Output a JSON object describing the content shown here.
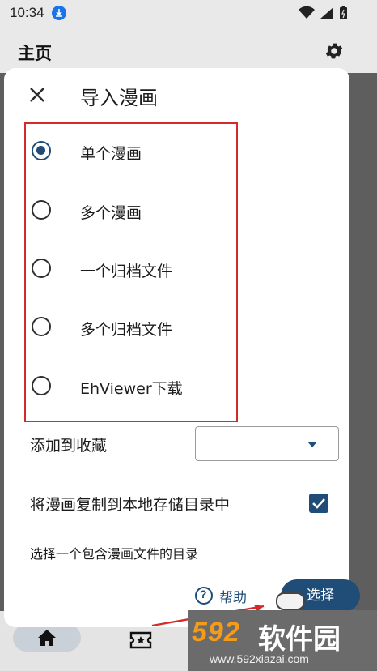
{
  "status_bar": {
    "time": "10:34"
  },
  "app_bar": {
    "title": "主页"
  },
  "dialog": {
    "title": "导入漫画",
    "import_options": [
      {
        "label": "单个漫画",
        "checked": true
      },
      {
        "label": "多个漫画",
        "checked": false
      },
      {
        "label": "一个归档文件",
        "checked": false
      },
      {
        "label": "多个归档文件",
        "checked": false
      },
      {
        "label": "EhViewer下载",
        "checked": false
      }
    ],
    "favorite": {
      "label": "添加到收藏",
      "value": ""
    },
    "copy_to_local": {
      "label": "将漫画复制到本地存储目录中",
      "checked": true
    },
    "directory_hint": "选择一个包含漫画文件的目录",
    "help_label": "帮助",
    "select_label": "选择"
  },
  "watermark": {
    "number": "592",
    "name": "软件园",
    "url": "www.592xiazai.com"
  },
  "colors": {
    "accent": "#1f4d78",
    "highlight_border": "#d42a2a",
    "watermark_orange": "#f59b1a"
  }
}
